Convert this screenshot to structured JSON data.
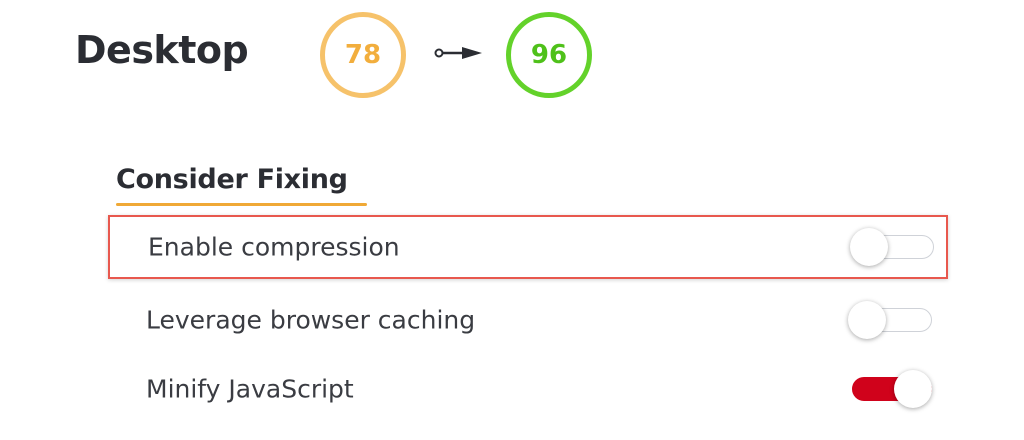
{
  "header": {
    "title": "Desktop",
    "score_before": "78",
    "score_after": "96",
    "colors": {
      "before_ring": "#f6c26a",
      "after_ring": "#63d22a"
    }
  },
  "section": {
    "title": "Consider Fixing"
  },
  "items": [
    {
      "label": "Enable compression",
      "enabled": false,
      "highlighted": true
    },
    {
      "label": "Leverage browser caching",
      "enabled": false,
      "highlighted": false
    },
    {
      "label": "Minify JavaScript",
      "enabled": true,
      "highlighted": false
    }
  ],
  "colors": {
    "accent_underline": "#f0a936",
    "toggle_on": "#d0021b",
    "highlight_border": "#e8584e"
  },
  "icons": {
    "arrow": "arrow-right-icon"
  }
}
